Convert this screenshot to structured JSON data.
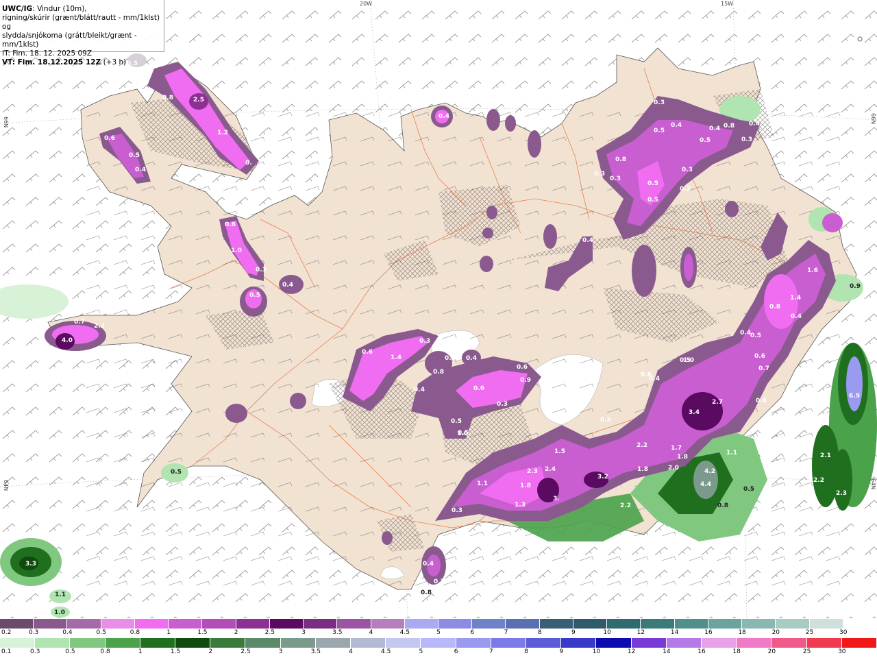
{
  "title": {
    "model": "UWC/IG",
    "desc1": ": Vindur (10m),",
    "desc2": "rigning/skúrir (grænt/blátt/rautt - mm/1klst) og",
    "desc3": "slydda/snjókoma (grátt/bleikt/grænt - mm/1klst)",
    "it": "IT: Fim. 18. 12. 2025 09Z",
    "vt": "VT: Fim. 18.12.2025 12Z",
    "vt_suffix": " (+3 h)"
  },
  "coords": {
    "lon_20w": "20W",
    "lon_15w": "15W",
    "lat_66n_left": "66N",
    "lat_66n_right": "66N",
    "lat_64n_left": "64N",
    "lat_64n_right": "64N"
  },
  "labels_snow": [
    "0.3",
    "0.8",
    "2.5",
    "1.2",
    "0.",
    "0.6",
    "0.5",
    "0.4",
    "0.6",
    "1.0",
    "0.3",
    "0.5",
    "0.4",
    "2.2",
    "4.0",
    "0.7",
    "0.6",
    "1.4",
    "0.3",
    "0.3",
    "0.4",
    "0.8",
    "0.6",
    "0.9",
    "0.6",
    "0.3",
    "0.4",
    "0.5",
    "1.0",
    "0.4",
    "0.3",
    "0.4",
    "0.5",
    "0.4",
    "0.5",
    "0.3",
    "0.4",
    "0.8",
    "0.8",
    "0.3",
    "0.5",
    "0.5",
    "0.3",
    "0.2",
    "0.3",
    "0.6",
    "0.5",
    "0.4",
    "1.0",
    "1.6",
    "1.4",
    "0.4",
    "0.5",
    "0.6",
    "0.7",
    "0.6",
    "0.4",
    "0.8",
    "2.7",
    "3.4",
    "2.2",
    "1.7",
    "1.8",
    "1.8",
    "2.0",
    "1.5",
    "2.3",
    "2.4",
    "3.2",
    "1.1",
    "1.8",
    "1.3",
    "3.",
    "2.2",
    "0.3",
    "0.4",
    "0.8",
    "0.5",
    "0.4",
    "0.7"
  ],
  "labels_rain": [
    "3.3",
    "1.1",
    "1.0",
    "0.5",
    "4.2",
    "4.4",
    "0.5",
    "0.8",
    "6.9",
    "2.1",
    "2.2",
    "2.3",
    "0.9",
    "1.1",
    "0.8"
  ],
  "colors": {
    "land": "#f1e2d2",
    "sea": "#ffffff",
    "roads": "#e8703a",
    "glacier": "#ffffff"
  },
  "scale_snow": {
    "labels": [
      "0.2",
      "0.3",
      "0.4",
      "0.5",
      "0.8",
      "1",
      "1.5",
      "2",
      "2.5",
      "3",
      "3.5",
      "4",
      "4.5",
      "5",
      "6",
      "7",
      "8",
      "9",
      "10",
      "12",
      "14",
      "16",
      "18",
      "20",
      "25",
      "30"
    ],
    "colors": [
      "#6b4a6b",
      "#8a5a8f",
      "#a46aaa",
      "#e88de8",
      "#f06cf0",
      "#c85ed0",
      "#b34db8",
      "#8e2f94",
      "#5a0a60",
      "#7a2d82",
      "#9a54a2",
      "#b57fbe",
      "#aaaaf2",
      "#8c8ce4",
      "#6f82c8",
      "#5c6fb0",
      "#3a5e78",
      "#2e5a6a",
      "#2e6a6e",
      "#3c7a7a",
      "#50908a",
      "#6aa49c",
      "#8ab8b0",
      "#a8ccc4",
      "#cfe0dc",
      "#ffffff"
    ]
  },
  "scale_rain": {
    "labels": [
      "0.1",
      "0.3",
      "0.5",
      "0.8",
      "1",
      "1.5",
      "2",
      "2.5",
      "3",
      "3.5",
      "4",
      "4.5",
      "5",
      "6",
      "7",
      "8",
      "9",
      "10",
      "12",
      "14",
      "16",
      "18",
      "20",
      "25",
      "30"
    ],
    "colors": [
      "#d8f2d8",
      "#b0e4b0",
      "#80c880",
      "#4aa24a",
      "#1f6f1f",
      "#0f4a0f",
      "#3a7a3a",
      "#5a8a6a",
      "#7c9a8c",
      "#9aa8ae",
      "#b4bad4",
      "#c4c8f0",
      "#b8b8f8",
      "#9a9af0",
      "#7a7ae8",
      "#5c5cd8",
      "#3a3ac8",
      "#0c0cb0",
      "#7a3ad8",
      "#b47ae8",
      "#e8a0e8",
      "#f07ac8",
      "#f05a8a",
      "#f03a50",
      "#f01818"
    ]
  }
}
